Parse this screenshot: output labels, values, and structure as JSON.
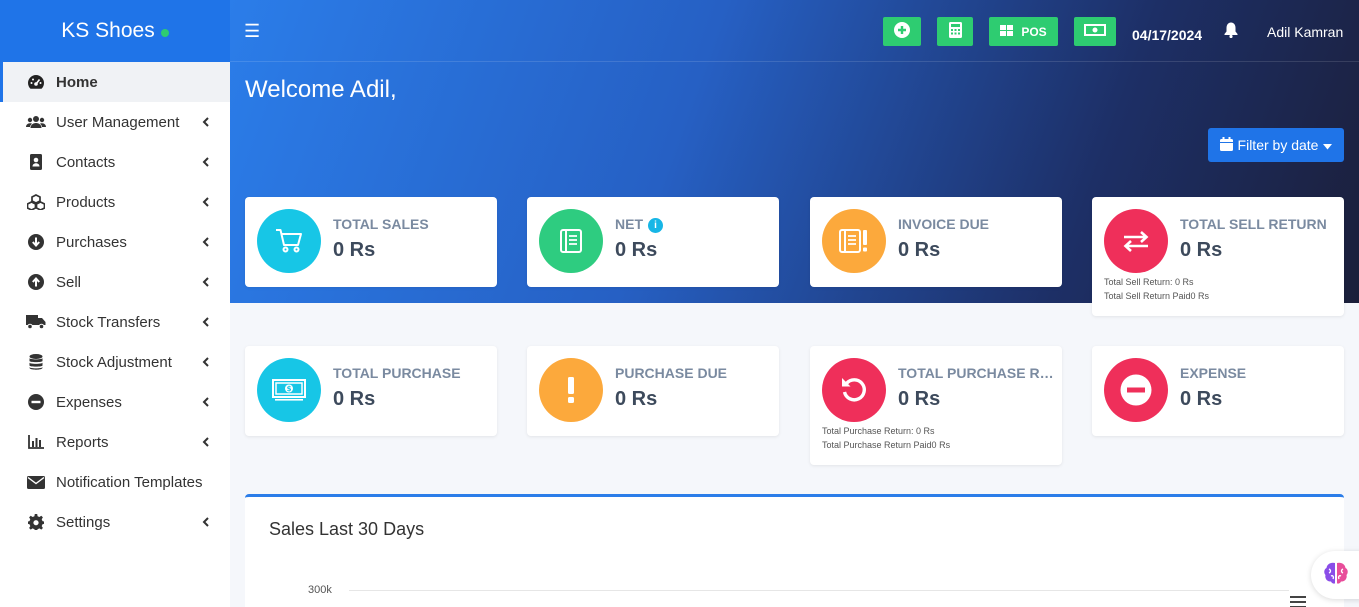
{
  "brand": {
    "name": "KS Shoes"
  },
  "sidebar": {
    "items": [
      {
        "label": "Home",
        "icon": "dashboard-icon"
      },
      {
        "label": "User Management",
        "icon": "users-icon"
      },
      {
        "label": "Contacts",
        "icon": "address-book-icon"
      },
      {
        "label": "Products",
        "icon": "cubes-icon"
      },
      {
        "label": "Purchases",
        "icon": "arrow-circle-down-icon"
      },
      {
        "label": "Sell",
        "icon": "arrow-circle-up-icon"
      },
      {
        "label": "Stock Transfers",
        "icon": "truck-icon"
      },
      {
        "label": "Stock Adjustment",
        "icon": "database-icon"
      },
      {
        "label": "Expenses",
        "icon": "minus-circle-icon"
      },
      {
        "label": "Reports",
        "icon": "bar-chart-icon"
      },
      {
        "label": "Notification Templates",
        "icon": "envelope-icon"
      },
      {
        "label": "Settings",
        "icon": "gear-icon"
      }
    ]
  },
  "header": {
    "pos_label": "POS",
    "date": "04/17/2024",
    "user_name": "Adil Kamran"
  },
  "main": {
    "welcome": "Welcome Adil,",
    "filter_label": "Filter by date"
  },
  "cards": {
    "total_sales": {
      "title": "TOTAL SALES",
      "value": "0 Rs"
    },
    "net": {
      "title": "NET",
      "value": "0 Rs"
    },
    "invoice_due": {
      "title": "INVOICE DUE",
      "value": "0 Rs"
    },
    "total_sell_return": {
      "title": "TOTAL SELL RETURN",
      "value": "0 Rs",
      "sub1": "Total Sell Return: 0 Rs",
      "sub2": "Total Sell Return Paid0 Rs"
    },
    "total_purchase": {
      "title": "TOTAL PURCHASE",
      "value": "0 Rs"
    },
    "purchase_due": {
      "title": "PURCHASE DUE",
      "value": "0 Rs"
    },
    "total_purchase_return": {
      "title": "TOTAL PURCHASE RETURN",
      "value": "0 Rs",
      "sub1": "Total Purchase Return: 0 Rs",
      "sub2": "Total Purchase Return Paid0 Rs"
    },
    "expense": {
      "title": "EXPENSE",
      "value": "0 Rs"
    }
  },
  "chart": {
    "title": "Sales Last 30 Days",
    "y_tick": "300k"
  },
  "colors": {
    "accent": "#1f74e8",
    "green": "#2ecc71",
    "cyan": "#17c6e6",
    "emerald": "#2ecc80",
    "orange": "#fca93c",
    "red": "#ef2f5a"
  }
}
